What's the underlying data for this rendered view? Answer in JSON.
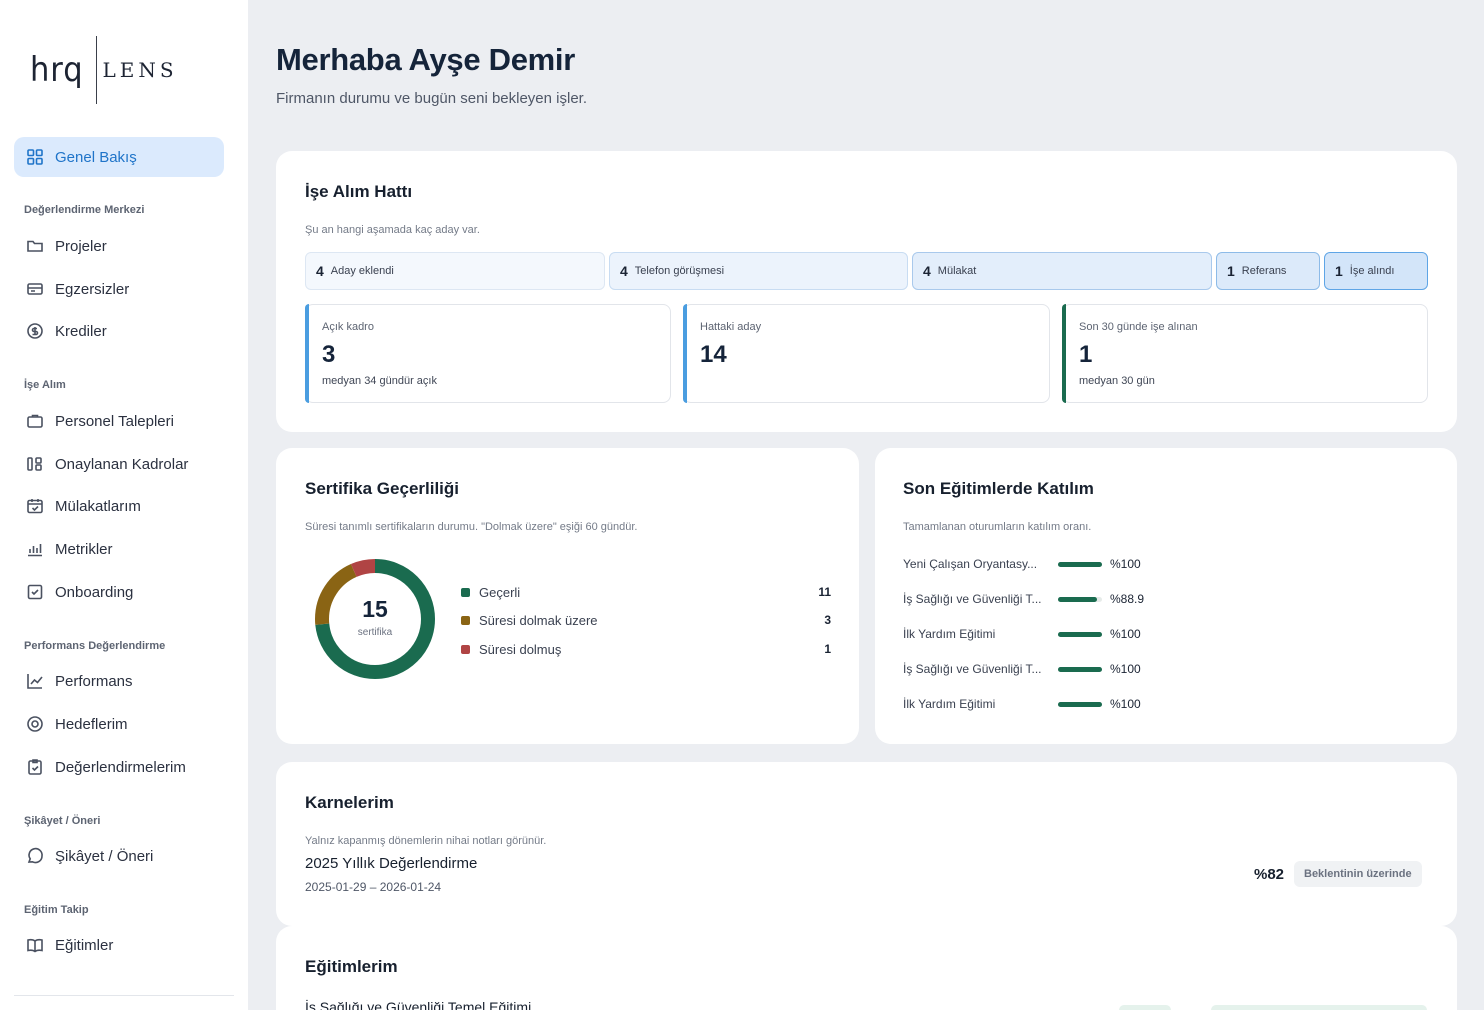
{
  "app": {
    "logo_mark": "hrq",
    "logo_text": "LENS"
  },
  "sidebar": {
    "active": {
      "label": "Genel Bakış",
      "icon": "grid-icon"
    },
    "sections": [
      {
        "title": "Değerlendirme Merkezi",
        "items": [
          {
            "label": "Projeler",
            "icon": "folder-icon"
          },
          {
            "label": "Egzersizler",
            "icon": "card-icon"
          },
          {
            "label": "Krediler",
            "icon": "coin-icon"
          }
        ]
      },
      {
        "title": "İşe Alım",
        "items": [
          {
            "label": "Personel Talepleri",
            "icon": "briefcase-icon"
          },
          {
            "label": "Onaylanan Kadrolar",
            "icon": "columns-icon"
          },
          {
            "label": "Mülakatlarım",
            "icon": "calendar-check-icon"
          },
          {
            "label": "Metrikler",
            "icon": "bar-chart-icon"
          },
          {
            "label": "Onboarding",
            "icon": "check-square-icon"
          }
        ]
      },
      {
        "title": "Performans Değerlendirme",
        "items": [
          {
            "label": "Performans",
            "icon": "line-chart-icon"
          },
          {
            "label": "Hedeflerim",
            "icon": "target-icon"
          },
          {
            "label": "Değerlendirmelerim",
            "icon": "clipboard-check-icon"
          }
        ]
      },
      {
        "title": "Şikâyet / Öneri",
        "items": [
          {
            "label": "Şikâyet / Öneri",
            "icon": "chat-icon"
          }
        ]
      },
      {
        "title": "Eğitim Takip",
        "items": [
          {
            "label": "Eğitimler",
            "icon": "book-icon"
          }
        ]
      }
    ]
  },
  "header": {
    "title": "Merhaba Ayşe Demir",
    "subtitle": "Firmanın durumu ve bugün seni bekleyen işler."
  },
  "pipeline": {
    "title": "İşe Alım Hattı",
    "subtitle": "Şu an hangi aşamada kaç aday var.",
    "stages": [
      {
        "count": "4",
        "label": "Aday eklendi"
      },
      {
        "count": "4",
        "label": "Telefon görüşmesi"
      },
      {
        "count": "4",
        "label": "Mülakat"
      },
      {
        "count": "1",
        "label": "Referans"
      },
      {
        "count": "1",
        "label": "İşe alındı"
      }
    ],
    "stats": [
      {
        "label": "Açık kadro",
        "value": "3",
        "foot": "medyan 34 gündür açık",
        "color": "#4a9de0"
      },
      {
        "label": "Hattaki aday",
        "value": "14",
        "foot": "",
        "color": "#4a9de0"
      },
      {
        "label": "Son 30 günde işe alınan",
        "value": "1",
        "foot": "medyan 30 gün",
        "color": "#1a6b4f"
      }
    ]
  },
  "certificates": {
    "title": "Sertifika Geçerliliği",
    "subtitle": "Süresi tanımlı sertifikaların durumu. \"Dolmak üzere\" eşiği 60 gündür.",
    "total": "15",
    "total_label": "sertifika",
    "legend": [
      {
        "name": "Geçerli",
        "value": 11,
        "color": "#1a6b4f"
      },
      {
        "name": "Süresi dolmak üzere",
        "value": 3,
        "color": "#8a6414"
      },
      {
        "name": "Süresi dolmuş",
        "value": 1,
        "color": "#b04444"
      }
    ]
  },
  "trainings_participation": {
    "title": "Son Eğitimlerde Katılım",
    "subtitle": "Tamamlanan oturumların katılım oranı.",
    "rows": [
      {
        "name": "Yeni Çalışan Oryantasy...",
        "value": "%100",
        "pct": 100
      },
      {
        "name": "İş Sağlığı ve Güvenliği T...",
        "value": "%88.9",
        "pct": 88.9
      },
      {
        "name": "İlk Yardım Eğitimi",
        "value": "%100",
        "pct": 100
      },
      {
        "name": "İş Sağlığı ve Güvenliği T...",
        "value": "%100",
        "pct": 100
      },
      {
        "name": "İlk Yardım Eğitimi",
        "value": "%100",
        "pct": 100
      }
    ]
  },
  "report_cards": {
    "title": "Karnelerim",
    "subtitle": "Yalnız kapanmış dönemlerin nihai notları görünür.",
    "item_name": "2025 Yıllık Değerlendirme",
    "item_dates": "2025-01-29 – 2026-01-24",
    "score": "%82",
    "badge": "Beklentinin üzerinde"
  },
  "my_trainings": {
    "title": "Eğitimlerim",
    "first_item": "İş Sağlığı ve Güvenliği Temel Eğitimi"
  },
  "colors": {
    "accent": "#1f74c9",
    "success": "#1a6b4f",
    "warning": "#8a6414",
    "danger": "#b04444"
  }
}
